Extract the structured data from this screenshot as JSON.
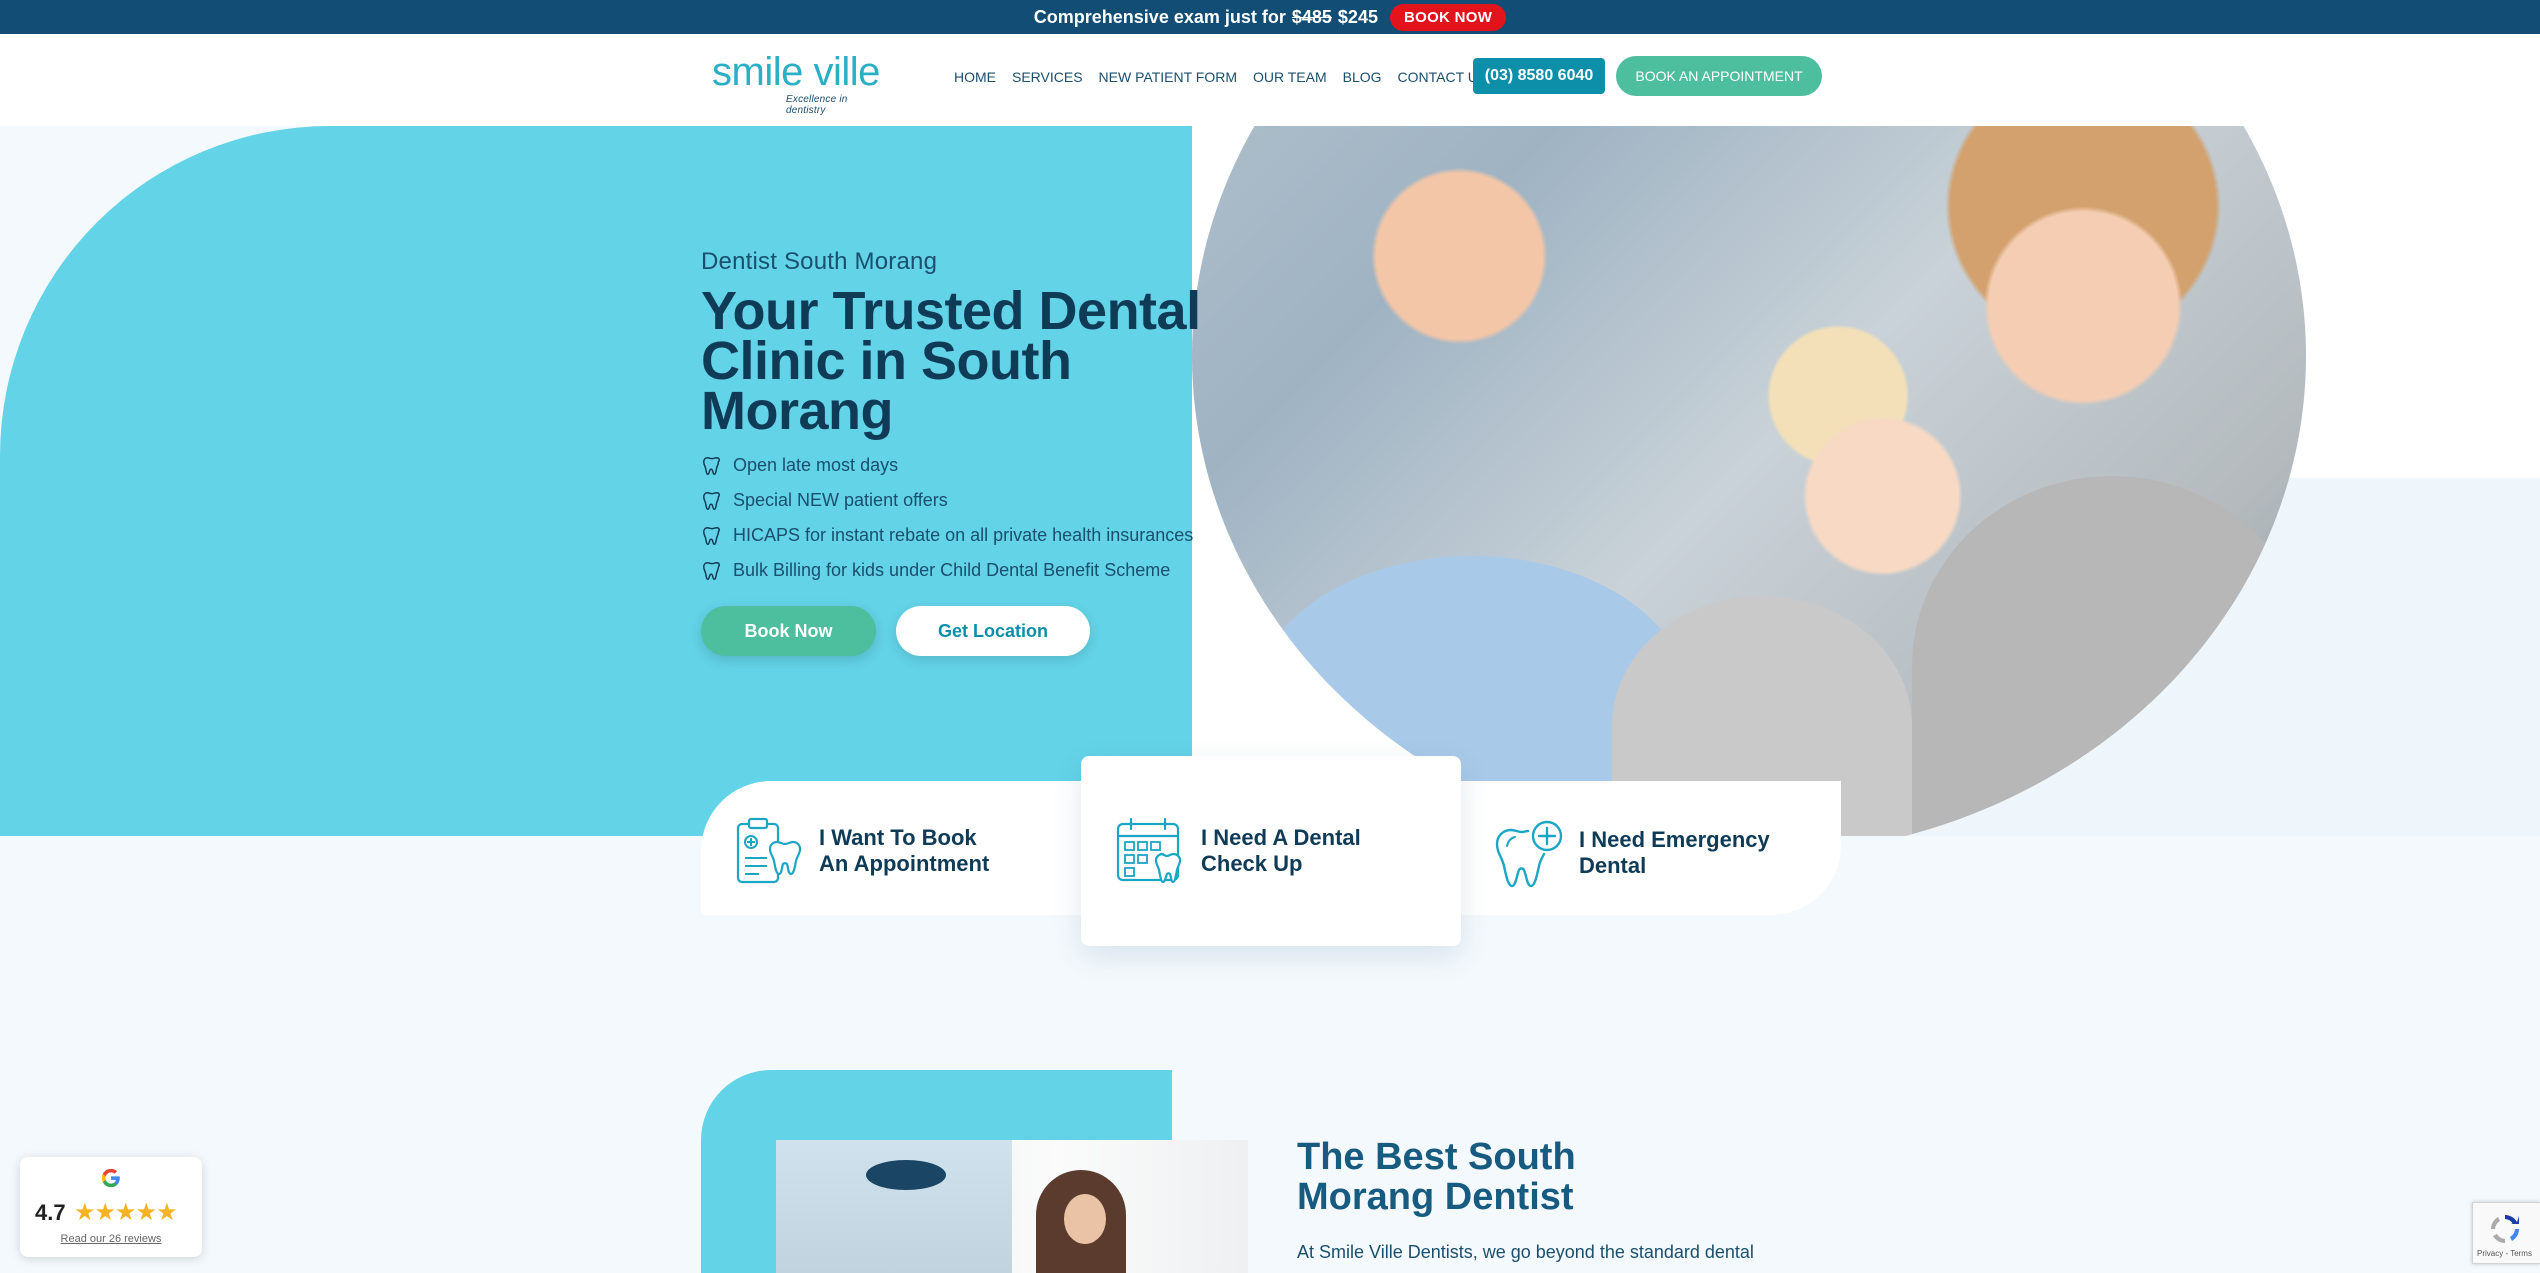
{
  "topbar": {
    "prefix": "Comprehensive exam just for",
    "old_price": "$485",
    "new_price": "$245",
    "cta": "BOOK NOW"
  },
  "header": {
    "logo_text": "smile ville",
    "logo_tagline": "Excellence in dentistry",
    "nav": [
      "HOME",
      "SERVICES",
      "NEW PATIENT FORM",
      "OUR TEAM",
      "BLOG",
      "CONTACT US"
    ],
    "phone": "(03) 8580 6040",
    "appointment_cta": "BOOK AN APPOINTMENT"
  },
  "hero": {
    "eyebrow": "Dentist South Morang",
    "title": "Your Trusted Dental Clinic in South Morang",
    "features": [
      "Open late most days",
      "Special NEW patient offers",
      "HICAPS for instant rebate on all private health insurances",
      "Bulk Billing for kids under Child Dental Benefit Scheme"
    ],
    "book_label": "Book Now",
    "location_label": "Get Location"
  },
  "cards": [
    {
      "label": "I Want To Book An Appointment",
      "icon": "clipboard-tooth-icon"
    },
    {
      "label": "I Need A Dental Check Up",
      "icon": "calendar-tooth-icon"
    },
    {
      "label": "I Need Emergency Dental",
      "icon": "tooth-plus-icon"
    }
  ],
  "about": {
    "title": "The Best South Morang Dentist",
    "text": "At Smile Ville Dentists, we go beyond the standard dental"
  },
  "reviews": {
    "score": "4.7",
    "stars": "★★★★★",
    "link": "Read our 26 reviews"
  },
  "recaptcha": {
    "terms": "Privacy - Terms"
  },
  "colors": {
    "topbar": "#114d74",
    "accent_cyan": "#63d3e7",
    "accent_green": "#4dbf9e",
    "phone_teal": "#0e8fa9",
    "heading_navy": "#0f3b57",
    "badge_red": "#e3131b"
  }
}
